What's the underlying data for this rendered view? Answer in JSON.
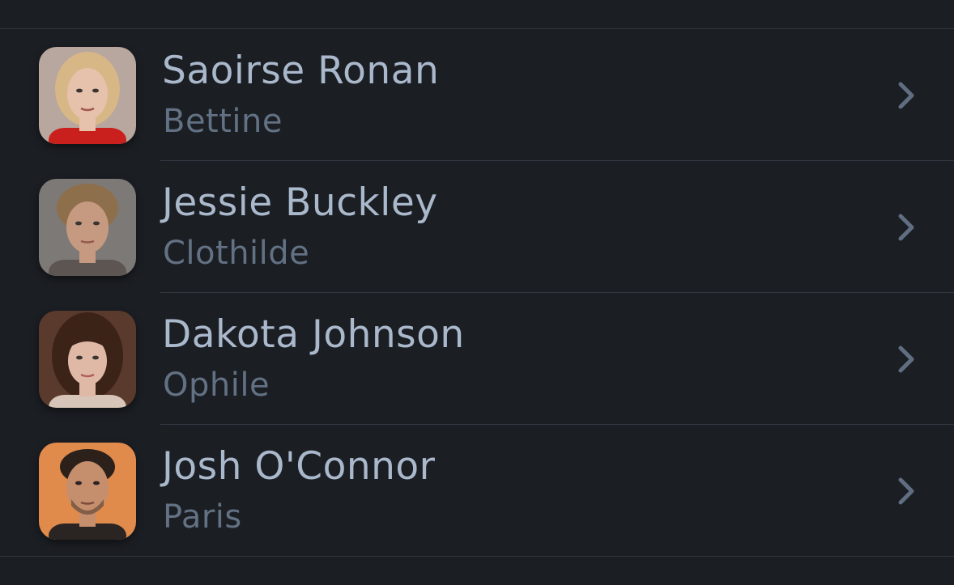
{
  "cast": [
    {
      "name": "Saoirse Ronan",
      "role": "Bettine",
      "avatar": {
        "bg": "#b8a79e",
        "hair": "#d8b787",
        "skin": "#e6c1ab",
        "clothes": "#c9201e"
      }
    },
    {
      "name": "Jessie Buckley",
      "role": "Clothilde",
      "avatar": {
        "bg": "#7d7976",
        "hair": "#8e6f4c",
        "skin": "#c69a80",
        "clothes": "#5c5552"
      }
    },
    {
      "name": "Dakota Johnson",
      "role": "Ophile",
      "avatar": {
        "bg": "#5a3a2c",
        "hair": "#3b2318",
        "skin": "#e0b9a6",
        "clothes": "#d6c5b8"
      }
    },
    {
      "name": "Josh O'Connor",
      "role": "Paris",
      "avatar": {
        "bg": "#e08a4c",
        "hair": "#2c211a",
        "skin": "#c58e6d",
        "clothes": "#2a2522"
      }
    }
  ],
  "chevron_icon": "chevron-right-icon",
  "colors": {
    "background": "#1b1e23",
    "name_text": "#aab8cc",
    "role_text": "#627183",
    "chevron": "#5f6e80",
    "divider": "#323842"
  }
}
